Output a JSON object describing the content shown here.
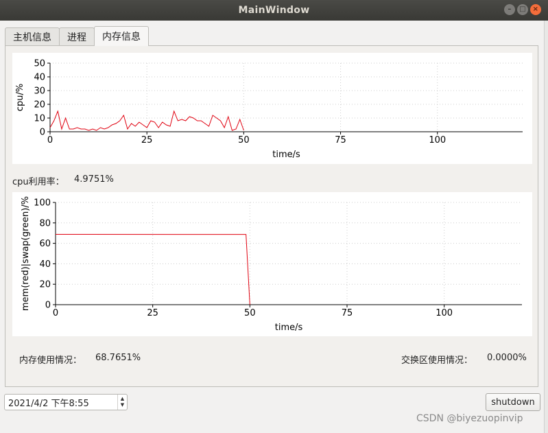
{
  "window": {
    "title": "MainWindow"
  },
  "tabs": [
    {
      "label": "主机信息",
      "active": false
    },
    {
      "label": "进程",
      "active": false
    },
    {
      "label": "内存信息",
      "active": true
    }
  ],
  "cpu_label": "cpu利用率：",
  "cpu_value": "4.9751%",
  "mem_label": "内存使用情况：",
  "mem_value": "68.7651%",
  "swap_label": "交换区使用情况：",
  "swap_value": "0.0000%",
  "datetime": "2021/4/2 下午8:55",
  "shutdown_label": "shutdown",
  "watermark": "CSDN @biyezuopinvip",
  "colors": {
    "mem_line": "#e0000f",
    "grid": "#cccccc"
  },
  "chart_data": [
    {
      "type": "line",
      "xlabel": "time/s",
      "ylabel": "cpu/%",
      "xlim": [
        0,
        122
      ],
      "ylim": [
        0,
        50
      ],
      "xticks": [
        0,
        25,
        50,
        75,
        100
      ],
      "yticks": [
        0,
        10,
        20,
        30,
        40,
        50
      ],
      "grid": true,
      "series": [
        {
          "color": "#e0000f",
          "x": [
            0,
            1,
            2,
            3,
            4,
            5,
            6,
            7,
            8,
            9,
            10,
            11,
            12,
            13,
            14,
            15,
            16,
            17,
            18,
            19,
            20,
            21,
            22,
            23,
            24,
            25,
            26,
            27,
            28,
            29,
            30,
            31,
            32,
            33,
            34,
            35,
            36,
            37,
            38,
            39,
            40,
            41,
            42,
            43,
            44,
            45,
            46,
            47,
            48,
            49,
            50
          ],
          "y": [
            3,
            8,
            15,
            2,
            10,
            2,
            2,
            3,
            2,
            2,
            1,
            2,
            1,
            3,
            2,
            3,
            5,
            6,
            8,
            12,
            2,
            6,
            4,
            7,
            5,
            3,
            8,
            7,
            3,
            7,
            5,
            4,
            15,
            8,
            9,
            8,
            11,
            10,
            8,
            8,
            6,
            4,
            12,
            10,
            8,
            3,
            11,
            1,
            2,
            9,
            1
          ]
        }
      ]
    },
    {
      "type": "line",
      "xlabel": "time/s",
      "ylabel": "mem(red)|swap(green)/%",
      "xlim": [
        0,
        120
      ],
      "ylim": [
        0,
        100
      ],
      "xticks": [
        0,
        25,
        50,
        75,
        100
      ],
      "yticks": [
        0,
        20,
        40,
        60,
        80,
        100
      ],
      "grid": true,
      "series": [
        {
          "color": "#e0000f",
          "x": [
            0,
            49,
            50
          ],
          "y": [
            68.8,
            68.7,
            0
          ]
        }
      ]
    }
  ]
}
